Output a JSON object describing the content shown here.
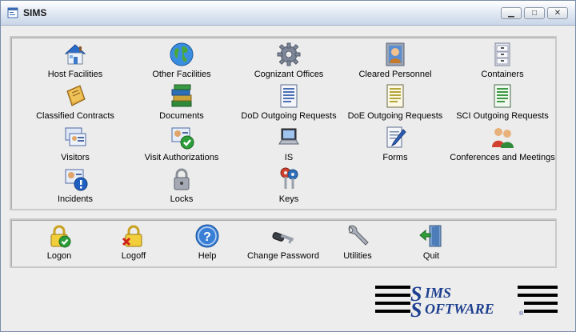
{
  "window": {
    "title": "SIMS",
    "minimize_label": "▁",
    "maximize_label": "□",
    "close_label": "✕"
  },
  "modules": [
    {
      "label": "Host Facilities",
      "icon": "house-icon"
    },
    {
      "label": "Other Facilities",
      "icon": "globe-icon"
    },
    {
      "label": "Cognizant Offices",
      "icon": "gear-icon"
    },
    {
      "label": "Cleared Personnel",
      "icon": "person-portrait-icon"
    },
    {
      "label": "Containers",
      "icon": "file-cabinet-icon"
    },
    {
      "label": "Classified Contracts",
      "icon": "notebook-icon"
    },
    {
      "label": "Documents",
      "icon": "book-stack-icon"
    },
    {
      "label": "DoD Outgoing Requests",
      "icon": "blue-document-icon"
    },
    {
      "label": "DoE Outgoing Requests",
      "icon": "yellow-document-icon"
    },
    {
      "label": "SCI Outgoing Requests",
      "icon": "green-document-icon"
    },
    {
      "label": "Visitors",
      "icon": "visitor-badges-icon"
    },
    {
      "label": "Visit Authorizations",
      "icon": "badge-check-icon"
    },
    {
      "label": "IS",
      "icon": "laptop-icon"
    },
    {
      "label": "Forms",
      "icon": "form-pencil-icon"
    },
    {
      "label": "Conferences and Meetings",
      "icon": "people-icon"
    },
    {
      "label": "Incidents",
      "icon": "badge-alert-icon"
    },
    {
      "label": "Locks",
      "icon": "padlock-icon"
    },
    {
      "label": "Keys",
      "icon": "keys-icon"
    }
  ],
  "actions": [
    {
      "label": "Logon",
      "icon": "lock-check-icon"
    },
    {
      "label": "Logoff",
      "icon": "lock-x-icon"
    },
    {
      "label": "Help",
      "icon": "help-icon"
    },
    {
      "label": "Change Password",
      "icon": "key-icon"
    },
    {
      "label": "Utilities",
      "icon": "wrench-icon"
    },
    {
      "label": "Quit",
      "icon": "exit-door-icon"
    }
  ],
  "logo": {
    "line1": "IMS",
    "line2": "OFTWARE",
    "letter": "S",
    "mark": "®"
  },
  "colors": {
    "logo_blue": "#1d3f8f",
    "titlebar": "#dfe7f2",
    "panel_bg": "#ececec"
  }
}
